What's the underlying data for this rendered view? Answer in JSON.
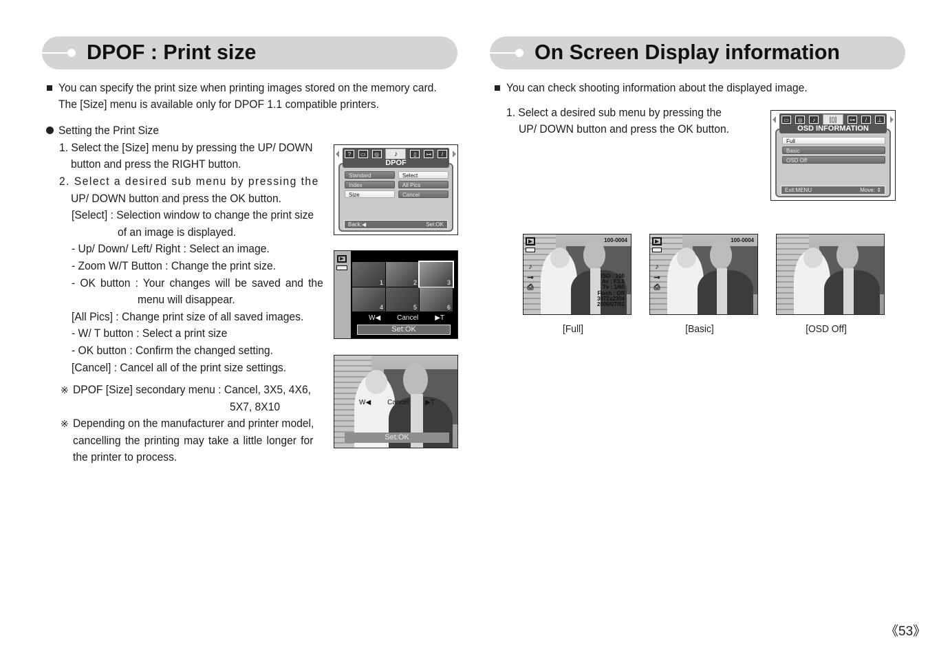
{
  "left": {
    "header": {
      "title": "DPOF : Print size"
    },
    "intro": [
      "You can specify the print size when printing images stored on the memory card.",
      "The [Size] menu is available only for DPOF 1.1 compatible printers."
    ],
    "section_title": "Setting the Print Size",
    "lines": [
      "1. Select the [Size] menu by pressing the UP/ DOWN",
      "button and press the RIGHT button.",
      "2. Select a desired sub menu by pressing the",
      "UP/ DOWN button and press the OK button.",
      "[Select] : Selection window to change the print size",
      "of an image is displayed.",
      "- Up/ Down/ Left/ Right : Select an image.",
      "- Zoom W/T Button : Change the print size.",
      "- OK button : Your changes will be saved and the",
      "menu will disappear.",
      "[All Pics] : Change print size of all saved images.",
      "- W/ T button : Select a print size",
      "- OK button : Confirm the changed setting.",
      "[Cancel] : Cancel all of the print size settings."
    ],
    "notes": [
      {
        "mark": "※",
        "lines": [
          "DPOF [Size] secondary menu : Cancel, 3X5, 4X6,",
          "5X7, 8X10"
        ]
      },
      {
        "mark": "※",
        "lines": [
          "Depending on the manufacturer and printer model,",
          "cancelling the printing may take a little longer for",
          "the printer to process."
        ]
      }
    ],
    "screen_dpof": {
      "title": "DPOF",
      "left_items": [
        "Standard",
        "Index",
        "Size"
      ],
      "left_selected": 2,
      "right_items": [
        "Select",
        "All Pics",
        "Cancel"
      ],
      "right_selected": 0,
      "footer_left": "Back:◀",
      "footer_right": "Set:OK"
    },
    "screen_thumbs": {
      "thumb_numbers": [
        "1",
        "2",
        "3",
        "4",
        "5",
        "6"
      ],
      "selected_thumb": 3,
      "zoom_row": {
        "w": "W◀",
        "value": "Cancel",
        "t": "▶T"
      },
      "set_label": "Set:OK"
    },
    "screen_single": {
      "zoom_row": {
        "w": "W◀",
        "value": "Cancel",
        "t": "▶T"
      },
      "set_label": "Set:OK"
    }
  },
  "right": {
    "header": {
      "title": "On Screen Display information"
    },
    "intro": "You can check shooting information about the displayed image.",
    "steps": [
      "1. Select a desired sub menu by pressing the",
      "UP/ DOWN button and press the OK button."
    ],
    "screen_osd": {
      "title": "OSD INFORMATION",
      "items": [
        "Full",
        "Basic",
        "OSD Off"
      ],
      "selected": 0,
      "footer_left": "Exit:MENU",
      "footer_right": "Move: ⇕"
    },
    "previews": [
      {
        "caption": "[Full]",
        "file_no": "100-0004",
        "info": [
          "ISO : 100",
          "Av : F3.5",
          "Tv : 1/60",
          "Flash : Off",
          "3072x2304",
          "2006/07/01"
        ]
      },
      {
        "caption": "[Basic]",
        "file_no": "100-0004",
        "info": []
      },
      {
        "caption": "[OSD Off]",
        "file_no": "",
        "info": []
      }
    ]
  },
  "page_number": "《53》"
}
